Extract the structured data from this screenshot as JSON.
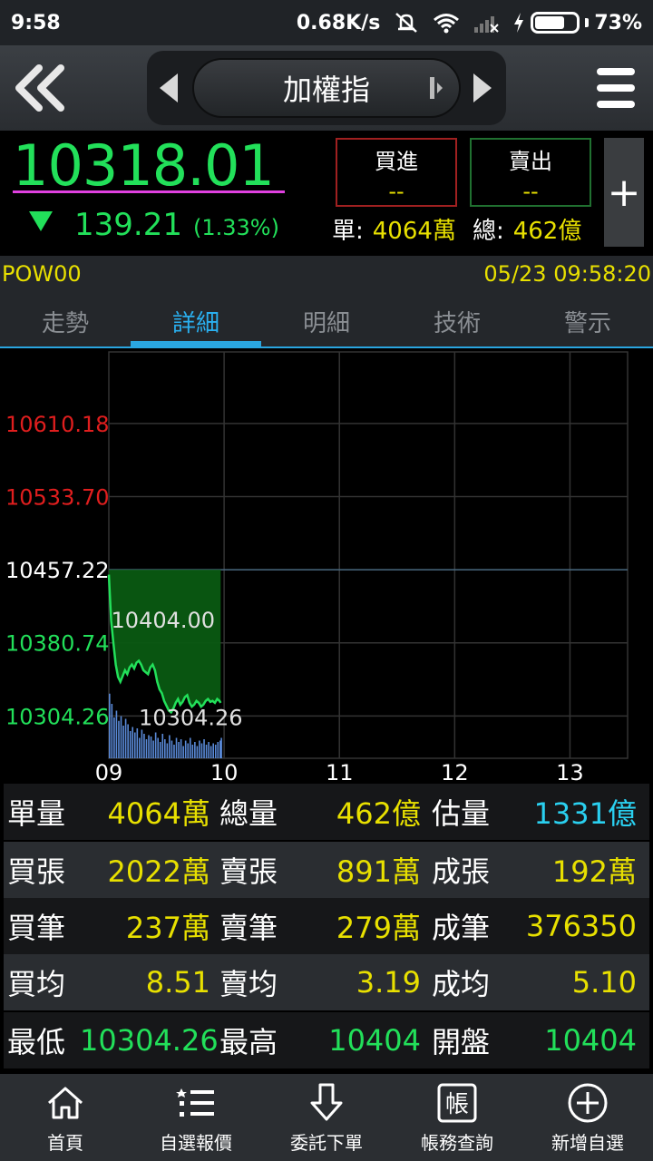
{
  "status_bar": {
    "time": "9:58",
    "net_speed": "0.68K/s",
    "battery": "73%",
    "battery_level": 0.73
  },
  "header": {
    "title": "加權指"
  },
  "quote": {
    "price": "10318.01",
    "change": "139.21",
    "change_pct": "(1.33%)",
    "bid_label": "買進",
    "bid_value": "--",
    "ask_label": "賣出",
    "ask_value": "--",
    "single_label": "單:",
    "single_value": "4064萬",
    "total_label": "總:",
    "total_value": "462億",
    "plus": "+"
  },
  "info_row": {
    "code": "POW00",
    "datetime": "05/23 09:58:20"
  },
  "tabs": [
    {
      "label": "走勢",
      "active": false
    },
    {
      "label": "詳細",
      "active": true
    },
    {
      "label": "明細",
      "active": false
    },
    {
      "label": "技術",
      "active": false
    },
    {
      "label": "警示",
      "active": false
    }
  ],
  "chart_data": {
    "type": "line",
    "y_ticks": [
      "10610.18",
      "10533.70",
      "10457.22",
      "10380.74",
      "10304.26"
    ],
    "y_tick_values": [
      10610.18,
      10533.7,
      10457.22,
      10380.74,
      10304.26
    ],
    "x_ticks": [
      "09",
      "10",
      "11",
      "12",
      "13"
    ],
    "reference": 10457.22,
    "ylim": [
      10260,
      10685
    ],
    "xlim": [
      9,
      13.5
    ],
    "high_label": "10404.00",
    "low_label": "10304.26",
    "x": [
      9.0,
      9.02,
      9.04,
      9.06,
      9.08,
      9.1,
      9.12,
      9.14,
      9.16,
      9.18,
      9.2,
      9.22,
      9.24,
      9.26,
      9.28,
      9.3,
      9.32,
      9.34,
      9.36,
      9.38,
      9.4,
      9.42,
      9.44,
      9.46,
      9.48,
      9.5,
      9.52,
      9.54,
      9.56,
      9.58,
      9.6,
      9.62,
      9.64,
      9.66,
      9.68,
      9.7,
      9.72,
      9.74,
      9.76,
      9.78,
      9.8,
      9.82,
      9.84,
      9.86,
      9.88,
      9.9,
      9.92,
      9.94,
      9.96,
      9.97
    ],
    "y": [
      10452,
      10404,
      10380,
      10358,
      10345,
      10340,
      10346,
      10352,
      10348,
      10355,
      10358,
      10354,
      10360,
      10362,
      10358,
      10352,
      10350,
      10348,
      10355,
      10358,
      10352,
      10340,
      10332,
      10328,
      10320,
      10315,
      10310,
      10308,
      10312,
      10318,
      10322,
      10316,
      10319,
      10324,
      10326,
      10318,
      10314,
      10316,
      10320,
      10318,
      10314,
      10316,
      10320,
      10322,
      10319,
      10320,
      10318,
      10322,
      10320,
      10318
    ],
    "volume": [
      95,
      80,
      60,
      70,
      55,
      62,
      48,
      58,
      50,
      40,
      46,
      38,
      44,
      30,
      42,
      36,
      28,
      34,
      32,
      26,
      38,
      30,
      24,
      36,
      28,
      22,
      34,
      26,
      20,
      30,
      24,
      28,
      18,
      26,
      22,
      30,
      20,
      24,
      18,
      26,
      22,
      28,
      20,
      24,
      18,
      22,
      20,
      24,
      26,
      30
    ],
    "line_color": "#22e05a",
    "fill_color": "#0a5a12",
    "up_color": "#e01e1e",
    "down_color": "#22e05a",
    "volume_color": "#5a8ad8"
  },
  "stats": {
    "r1": {
      "l1": "單量",
      "v1": "4064萬",
      "l2": "總量",
      "v2": "462億",
      "l3": "估量",
      "v3": "1331億"
    },
    "r2": {
      "l1": "買張",
      "v1": "2022萬",
      "l2": "賣張",
      "v2": "891萬",
      "l3": "成張",
      "v3": "192萬"
    },
    "r3": {
      "l1": "買筆",
      "v1": "237萬",
      "l2": "賣筆",
      "v2": "279萬",
      "l3": "成筆",
      "v3": "376350"
    },
    "r4": {
      "l1": "買均",
      "v1": "8.51",
      "l2": "賣均",
      "v2": "3.19",
      "l3": "成均",
      "v3": "5.10"
    },
    "r5": {
      "l1": "最低",
      "v1": "10304.26",
      "l2": "最高",
      "v2": "10404",
      "l3": "開盤",
      "v3": "10404"
    }
  },
  "bottom_nav": [
    {
      "label": "首頁",
      "icon": "home-icon"
    },
    {
      "label": "自選報價",
      "icon": "list-icon"
    },
    {
      "label": "委託下單",
      "icon": "order-down-icon"
    },
    {
      "label": "帳務查詢",
      "icon": "account-icon"
    },
    {
      "label": "新增自選",
      "icon": "add-circle-icon"
    }
  ],
  "account_glyph": "帳"
}
